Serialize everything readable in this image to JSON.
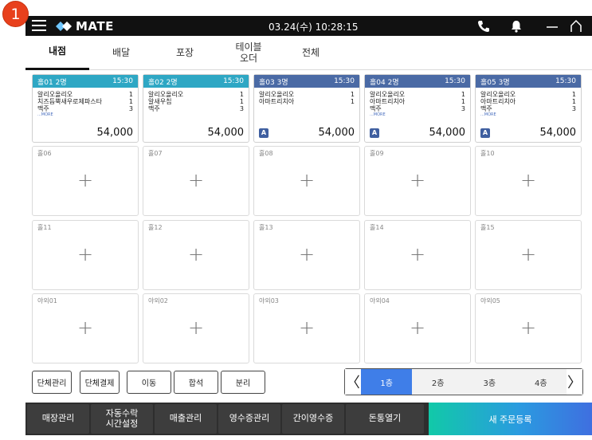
{
  "step_badge": "1",
  "status_bar": {
    "app_name": "MATE",
    "datetime": "03.24(수) 10:28:15",
    "icons": [
      "menu-icon",
      "phone-icon",
      "bell-icon",
      "minimize-icon",
      "home-icon"
    ]
  },
  "tabs": [
    {
      "label": "내점",
      "active": true
    },
    {
      "label": "배달",
      "active": false
    },
    {
      "label": "포장",
      "active": false
    },
    {
      "label": "테이블\n오더",
      "active": false
    },
    {
      "label": "전체",
      "active": false
    }
  ],
  "occupied_tables": [
    {
      "name": "홀01 2명",
      "time": "15:30",
      "color": "#2ea7c4",
      "items": [
        {
          "n": "알리오올리오",
          "q": "1"
        },
        {
          "n": "치즈듬뿍새우로제파스타",
          "q": "1"
        },
        {
          "n": "맥주",
          "q": "3"
        }
      ],
      "more": "...MORE",
      "badge": "",
      "total": "54,000"
    },
    {
      "name": "홀02 2명",
      "time": "15:30",
      "color": "#2ea7c4",
      "items": [
        {
          "n": "알리오올리오",
          "q": "1"
        },
        {
          "n": "알새우칩",
          "q": "1"
        },
        {
          "n": "맥주",
          "q": "3"
        }
      ],
      "more": "",
      "badge": "",
      "total": "54,000"
    },
    {
      "name": "홀03 3명",
      "time": "15:30",
      "color": "#4a6aa5",
      "items": [
        {
          "n": "알리오올리오",
          "q": "1"
        },
        {
          "n": "아마트리치아",
          "q": "1"
        }
      ],
      "more": "",
      "badge": "A",
      "total": "54,000"
    },
    {
      "name": "홀04 2명",
      "time": "15:30",
      "color": "#4a6aa5",
      "items": [
        {
          "n": "알리오올리오",
          "q": "1"
        },
        {
          "n": "아마트리치아",
          "q": "1"
        },
        {
          "n": "맥주",
          "q": "3"
        }
      ],
      "more": "...MORE",
      "badge": "A",
      "total": "54,000"
    },
    {
      "name": "홀05 3명",
      "time": "15:30",
      "color": "#4a6aa5",
      "items": [
        {
          "n": "알리오올리오",
          "q": "1"
        },
        {
          "n": "아마트리치아",
          "q": "1"
        },
        {
          "n": "맥주",
          "q": "3"
        }
      ],
      "more": "...MORE",
      "badge": "A",
      "total": "54,000"
    }
  ],
  "empty_tables": [
    "홀06",
    "홀07",
    "홀08",
    "홀09",
    "홀10",
    "홀11",
    "홀12",
    "홀13",
    "홀14",
    "홀15",
    "야외01",
    "야외02",
    "야외03",
    "야외04",
    "야외05"
  ],
  "empty_plus": "+",
  "action_buttons": [
    "단체관리",
    "단체결제",
    "이동",
    "합석",
    "분리"
  ],
  "floors": [
    {
      "label": "1층",
      "active": true
    },
    {
      "label": "2층",
      "active": false
    },
    {
      "label": "3층",
      "active": false
    },
    {
      "label": "4층",
      "active": false
    }
  ],
  "floor_prev": "〈",
  "floor_next": "〉",
  "bottom_buttons": [
    "매장관리",
    "자동수락\n시간설정",
    "매출관리",
    "영수증관리",
    "간이영수증",
    "돈통열기"
  ],
  "new_order_label": "새 주문등록"
}
